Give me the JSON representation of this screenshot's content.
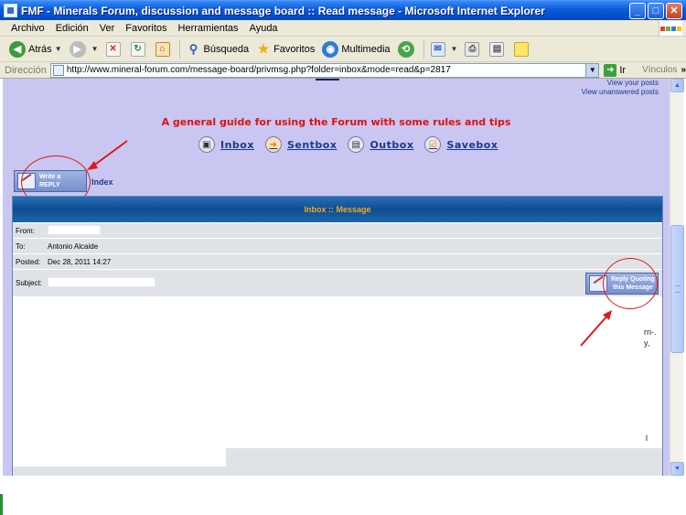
{
  "window": {
    "title": "FMF - Minerals Forum, discussion and message board :: Read message - Microsoft Internet Explorer",
    "buttons": {
      "minimize": "_",
      "maximize": "□",
      "close": "✕"
    }
  },
  "menubar": {
    "items": [
      "Archivo",
      "Edición",
      "Ver",
      "Favoritos",
      "Herramientas",
      "Ayuda"
    ]
  },
  "toolbar": {
    "back": "Atrás",
    "search": "Búsqueda",
    "favorites": "Favoritos",
    "media": "Multimedia"
  },
  "addressbar": {
    "label": "Dirección",
    "url": "http://www.mineral-forum.com/message-board/privmsg.php?folder=inbox&mode=read&p=2817",
    "go": "Ir",
    "links": "Vínculos"
  },
  "page": {
    "top_links": [
      "View your posts",
      "View unanswered posts"
    ],
    "guide_link": "A general guide for using the Forum with some rules and tips",
    "nav": [
      {
        "label": "Inbox",
        "icon": "inbox-icon"
      },
      {
        "label": "Sentbox",
        "icon": "sentbox-icon"
      },
      {
        "label": "Outbox",
        "icon": "outbox-icon"
      },
      {
        "label": "Savebox",
        "icon": "savebox-icon"
      }
    ],
    "write_reply": [
      "Write a",
      "REPLY"
    ],
    "index_link": "Index",
    "message": {
      "header": "Inbox :: Message",
      "from_label": "From:",
      "to_label": "To:",
      "to_value": "Antonio Alcaide",
      "posted_label": "Posted:",
      "posted_value": "Dec 28, 2011 14:27",
      "subject_label": "Subject:",
      "reply_quote": [
        "Reply Quoting",
        "this Message"
      ],
      "fragments": [
        "rn-.",
        "y,",
        "l"
      ]
    }
  },
  "colors": {
    "page_bg": "#c9c7f2",
    "guide_red": "#e01010",
    "link_blue": "#1b3a8a",
    "header_orange": "#f5a623",
    "annotation_red": "#e01818"
  }
}
